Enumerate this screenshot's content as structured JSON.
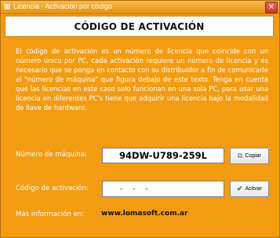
{
  "window": {
    "title": "Licencia - Activación por código",
    "close_glyph": "✕"
  },
  "header": {
    "title": "CÓDIGO DE ACTIVACIÓN"
  },
  "body": {
    "paragraph": "El código de activación es un número de licencia que coincide con un número único por PC, cada activación requiere un número de licencia y es necesario que se ponga en contacto con su distribuidor a fin de comunicarle el \"número de máquina\" que figura debajo de este texto. Tenga en cuenta que las licencias en este caso solo funcionan en una sola PC, para usar una licencia en diferentes PC's tiene que adquirir una licencia bajo la modalidad de llave de hardware."
  },
  "machine": {
    "label": "Número de máquina:",
    "value": "94DW-U789-259L",
    "copy_label": "Copiar",
    "copy_icon": "copy-icon"
  },
  "activation": {
    "label": "Código de activación:",
    "value": "  -  -  -",
    "activate_label": "Activar",
    "activate_icon": "check-icon"
  },
  "footer": {
    "label": "Más información en:",
    "link": "www.lomasoft.com.ar"
  },
  "colors": {
    "background": "#f39c12",
    "text": "#ffffff",
    "header_bg": "#ffffff"
  }
}
